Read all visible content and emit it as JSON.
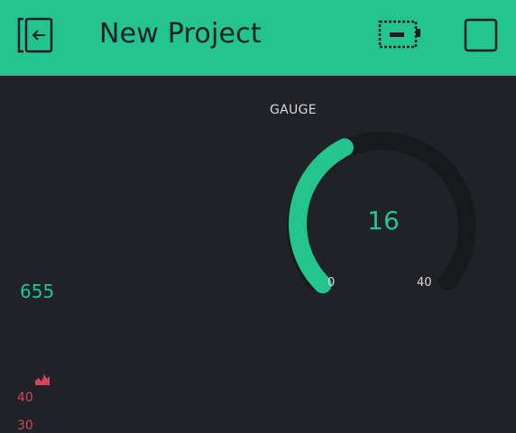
{
  "header": {
    "title": "New Project"
  },
  "gauge": {
    "label": "GAUGE",
    "value": "16",
    "min": "0",
    "max": "40",
    "fill_color": "#23c48e",
    "track_color": "#1a1b1f"
  },
  "value_display": {
    "value": "655",
    "color": "#23c48e"
  },
  "chart": {
    "color": "#d3455b",
    "y_ticks": [
      "40",
      "30"
    ]
  },
  "icons": {
    "back": "exit-door-icon",
    "battery": "battery-icon",
    "square": "square-icon",
    "chart": "area-chart-icon"
  },
  "colors": {
    "accent": "#23c48e",
    "background": "#212227"
  }
}
